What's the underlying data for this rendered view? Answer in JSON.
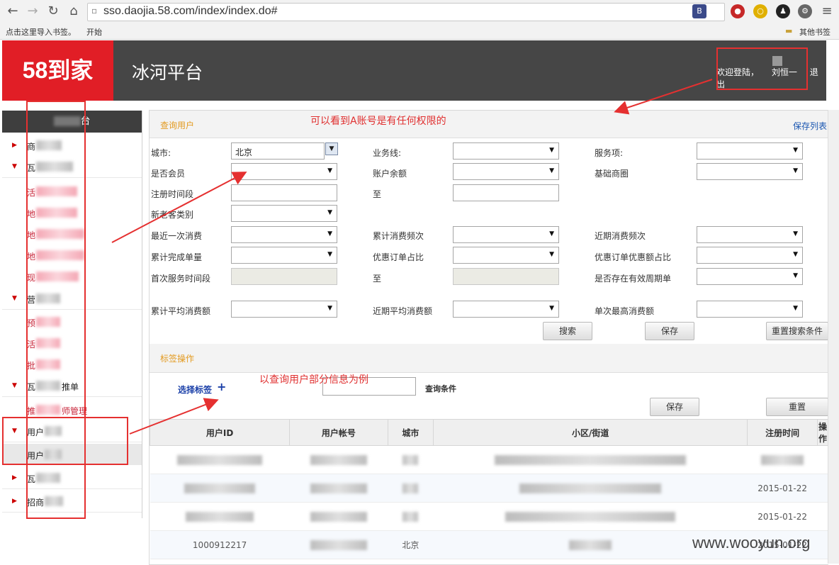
{
  "browser": {
    "url": "sso.daojia.58.com/index/index.do#",
    "bookmarks_hint": "点击这里导入书签。",
    "bookmarks_start": "开始",
    "other_bookmarks": "其他书签"
  },
  "header": {
    "logo": "58到家",
    "platform": "冰河平台",
    "welcome": "欢迎登陆，",
    "user": "刘恒一",
    "logout": "退出"
  },
  "sidebar": {
    "title": "台",
    "groups": [
      "商",
      "瓦",
      "营",
      "瓦",
      "用户",
      "瓦",
      "招商"
    ],
    "children": [
      "活",
      "地",
      "地",
      "地",
      "现",
      "预",
      "活",
      "批",
      "推单",
      "推",
      "师管理",
      "用户"
    ]
  },
  "query": {
    "title": "查询用户",
    "save_list": "保存列表",
    "labels": {
      "city": "城市:",
      "business_line": "业务线:",
      "service_item": "服务项:",
      "is_member": "是否会员",
      "balance": "账户余额",
      "base_circle": "基础商圈",
      "reg_period": "注册时间段",
      "to": "至",
      "new_old": "新老客类别",
      "last_consume": "最近一次消费",
      "total_freq": "累计消费频次",
      "recent_freq": "近期消费频次",
      "total_orders": "累计完成单量",
      "coupon_ratio": "优惠订单占比",
      "coupon_amount_ratio": "优惠订单优惠额占比",
      "first_service": "首次服务时间段",
      "cycle_order": "是否存在有效周期单",
      "avg_consume": "累计平均消费额",
      "recent_avg": "近期平均消费额",
      "max_consume": "单次最高消费额"
    },
    "city_value": "北京",
    "buttons": {
      "search": "搜索",
      "save": "保存",
      "reset": "重置搜索条件"
    }
  },
  "tags": {
    "title": "标签操作",
    "select_tags": "选择标签",
    "query_condition": "查询条件",
    "save": "保存",
    "reset": "重置"
  },
  "table": {
    "headers": [
      "用户ID",
      "用户帐号",
      "城市",
      "小区/街道",
      "注册时间",
      "操作"
    ],
    "rows": [
      {
        "id": "",
        "city": "",
        "date": ""
      },
      {
        "id": "",
        "city": "",
        "date": "2015-01-22"
      },
      {
        "id": "",
        "city": "",
        "date": "2015-01-22"
      },
      {
        "id": "1000912217",
        "city": "北京",
        "date": "2015-01-22"
      }
    ]
  },
  "annotations": {
    "note1": "可以看到A账号是有任何权限的",
    "note2": "以查询用户部分信息为例"
  },
  "watermark": "www.wooyun.org",
  "colors": {
    "brand_red": "#e11e26",
    "header_bg": "#464646",
    "accent_orange": "#e39a1f",
    "annotation_red": "#e03030"
  }
}
